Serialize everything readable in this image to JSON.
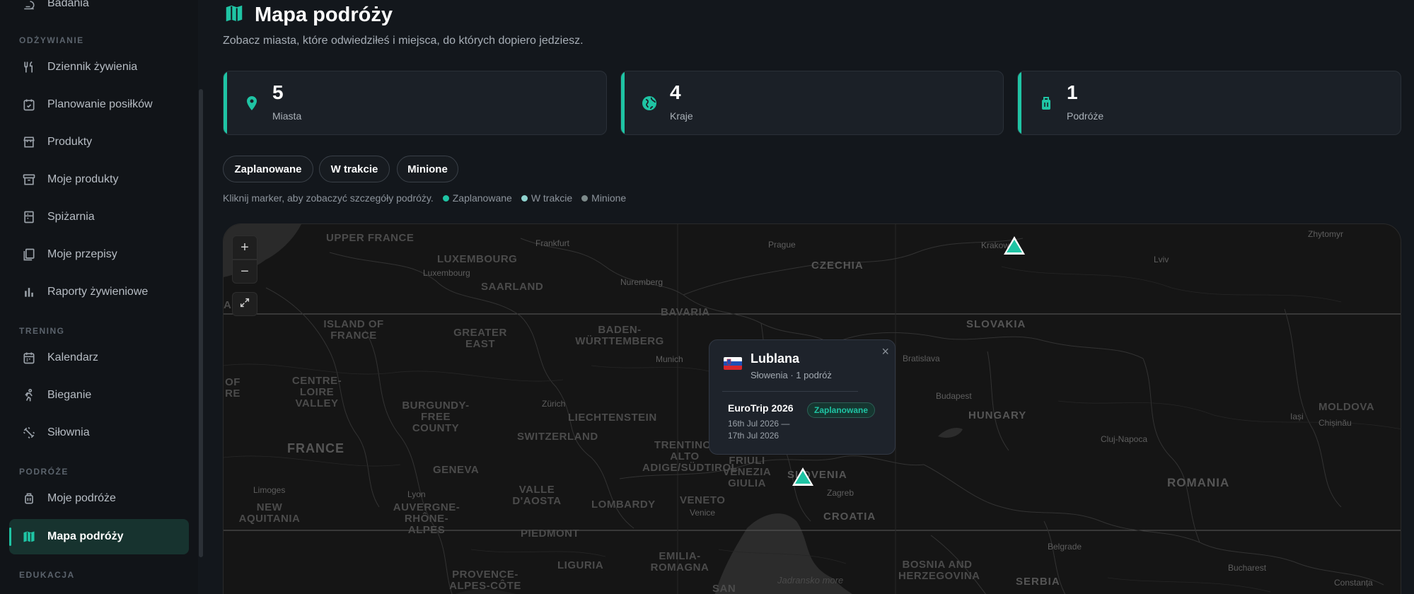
{
  "sidebar": {
    "top_item": "Badania",
    "sections": [
      {
        "label": "ODŻYWIANIE"
      },
      {
        "label": "TRENING"
      },
      {
        "label": "PODRÓŻE"
      },
      {
        "label": "EDUKACJA"
      }
    ],
    "items": [
      {
        "label": "Dziennik żywienia",
        "icon": "fork-knife-icon"
      },
      {
        "label": "Planowanie posiłków",
        "icon": "calendar-check-icon"
      },
      {
        "label": "Produkty",
        "icon": "store-icon"
      },
      {
        "label": "Moje produkty",
        "icon": "archive-icon"
      },
      {
        "label": "Spiżarnia",
        "icon": "pantry-icon"
      },
      {
        "label": "Moje przepisy",
        "icon": "book-icon"
      },
      {
        "label": "Raporty żywieniowe",
        "icon": "bar-chart-icon"
      },
      {
        "label": "Kalendarz",
        "icon": "calendar-icon"
      },
      {
        "label": "Bieganie",
        "icon": "runner-icon"
      },
      {
        "label": "Siłownia",
        "icon": "dumbbell-icon"
      },
      {
        "label": "Moje podróże",
        "icon": "luggage-icon"
      },
      {
        "label": "Mapa podróży",
        "icon": "map-icon",
        "active": true
      }
    ]
  },
  "header": {
    "title": "Mapa podróży",
    "subtitle": "Zobacz miasta, które odwiedziłeś i miejsca, do których dopiero jedziesz."
  },
  "stats": [
    {
      "value": "5",
      "label": "Miasta",
      "icon": "pin-icon"
    },
    {
      "value": "4",
      "label": "Kraje",
      "icon": "globe-icon"
    },
    {
      "value": "1",
      "label": "Podróże",
      "icon": "luggage-icon"
    }
  ],
  "filters": [
    "Zaplanowane",
    "W trakcie",
    "Minione"
  ],
  "legend": {
    "hint": "Kliknij marker, aby zobaczyć szczegóły podróży.",
    "items": [
      {
        "label": "Zaplanowane",
        "color": "#1fc4a4"
      },
      {
        "label": "W trakcie",
        "color": "#8fd3cf"
      },
      {
        "label": "Minione",
        "color": "#7d8a8a"
      }
    ]
  },
  "map": {
    "zoom_in": "+",
    "zoom_out": "−",
    "regions": [
      "UPPER FRANCE",
      "LUXEMBOURG",
      "SAARLAND",
      "CZECHIA",
      "BAVARIA",
      "SLOVAKIA",
      "ISLAND OF FRANCE",
      "GREATER EAST",
      "BADEN-WÜRTTEMBERG",
      "CENTRE-LOIRE VALLEY",
      "BURGUNDY-FREE COUNTY",
      "LIECHTENSTEIN",
      "HUNGARY",
      "MOLDOVA",
      "FRANCE",
      "SWITZERLAND",
      "TRENTINO-ALTO ADIGE/SÜDTIROL",
      "FRIULI VENEZIA GIULIA",
      "SLOVENIA",
      "GENEVA",
      "VALLE D'AOSTA",
      "LOMBARDY",
      "VENETO",
      "ROMANIA",
      "NEW AQUITANIA",
      "AUVERGNE-RHÔNE-ALPES",
      "CROATIA",
      "PIEDMONT",
      "LIGURIA",
      "EMILIA-ROMAGNA",
      "PROVENCE-ALPES-CÔTE",
      "SAN",
      "BOSNIA AND HERZEGOVINA",
      "SERBIA",
      "ANDY",
      "OF RE"
    ],
    "cities": [
      "Frankfurt",
      "Prague",
      "Krakow",
      "Zhytomyr",
      "Luxembourg",
      "Lviv",
      "Nuremberg",
      "Munich",
      "Bratislava",
      "Budapest",
      "Iași",
      "Chișinău",
      "Zürich",
      "Cluj-Napoca",
      "Limoges",
      "Lyon",
      "Venice",
      "Zagreb",
      "Belgrade",
      "Bucharest",
      "Constanța",
      "Jadransko more"
    ]
  },
  "popup": {
    "city": "Lublana",
    "meta": "Słowenia · 1 podróż",
    "close": "×",
    "trip_name": "EuroTrip 2026",
    "badge": "Zaplanowane",
    "dates_line1": "16th Jul 2026 —",
    "dates_line2": "17th Jul 2026"
  }
}
